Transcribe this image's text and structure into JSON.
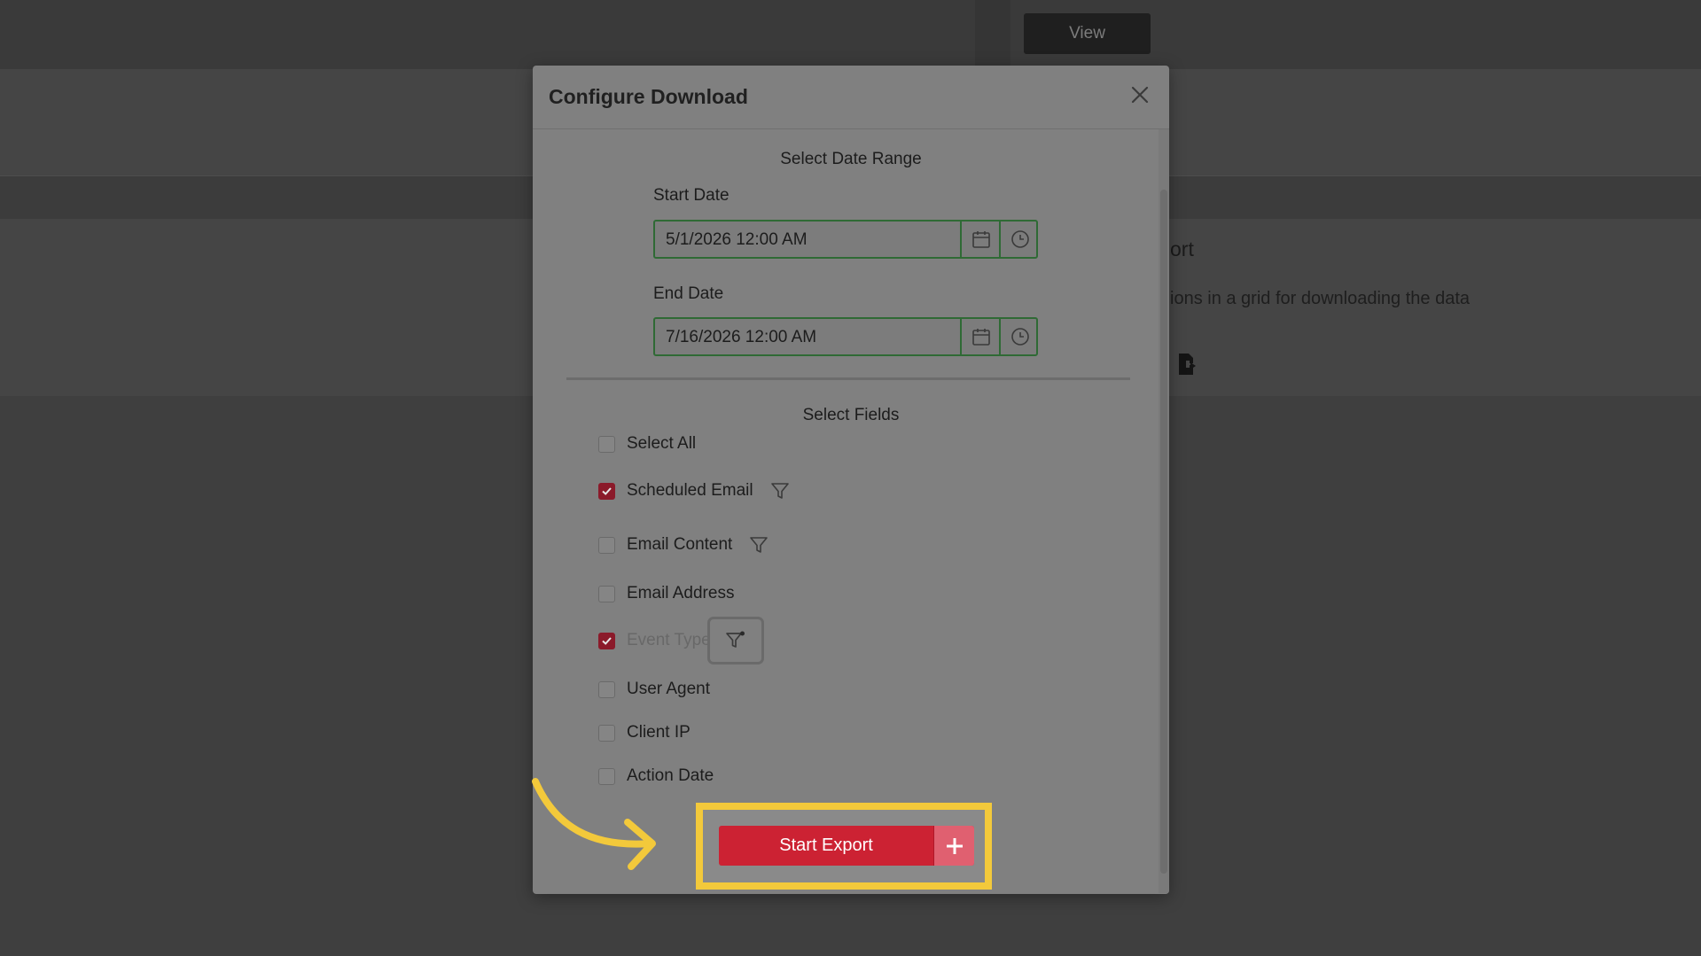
{
  "background": {
    "view_button": "View",
    "card_title": "ort",
    "card_description": "ions in a grid for downloading the data"
  },
  "modal": {
    "title": "Configure Download",
    "date_range": {
      "heading": "Select Date Range",
      "start_label": "Start Date",
      "start_value": "5/1/2026 12:00 AM",
      "end_label": "End Date",
      "end_value": "7/16/2026 12:00 AM"
    },
    "fields": {
      "heading": "Select Fields",
      "items": [
        {
          "label": "Select All",
          "checked": false,
          "filter": false
        },
        {
          "label": "Scheduled Email",
          "checked": true,
          "filter": true
        },
        {
          "label": "Email Content",
          "checked": false,
          "filter": true
        },
        {
          "label": "Email Address",
          "checked": false,
          "filter": false
        },
        {
          "label": "Event Type",
          "checked": true,
          "filter": true,
          "filter_active": true
        },
        {
          "label": "User Agent",
          "checked": false,
          "filter": false
        },
        {
          "label": "Client IP",
          "checked": false,
          "filter": false
        },
        {
          "label": "Action Date",
          "checked": false,
          "filter": false
        }
      ]
    },
    "start_export_label": "Start Export"
  },
  "colors": {
    "accent_red": "#cc2233",
    "highlight_yellow": "#f3c93b",
    "input_border_green": "#2f6a35"
  },
  "icons": [
    "close-icon",
    "calendar-icon",
    "clock-icon",
    "filter-icon",
    "filter-add-icon",
    "plus-icon",
    "checkmark-icon",
    "export-file-icon",
    "curved-arrow-icon"
  ]
}
